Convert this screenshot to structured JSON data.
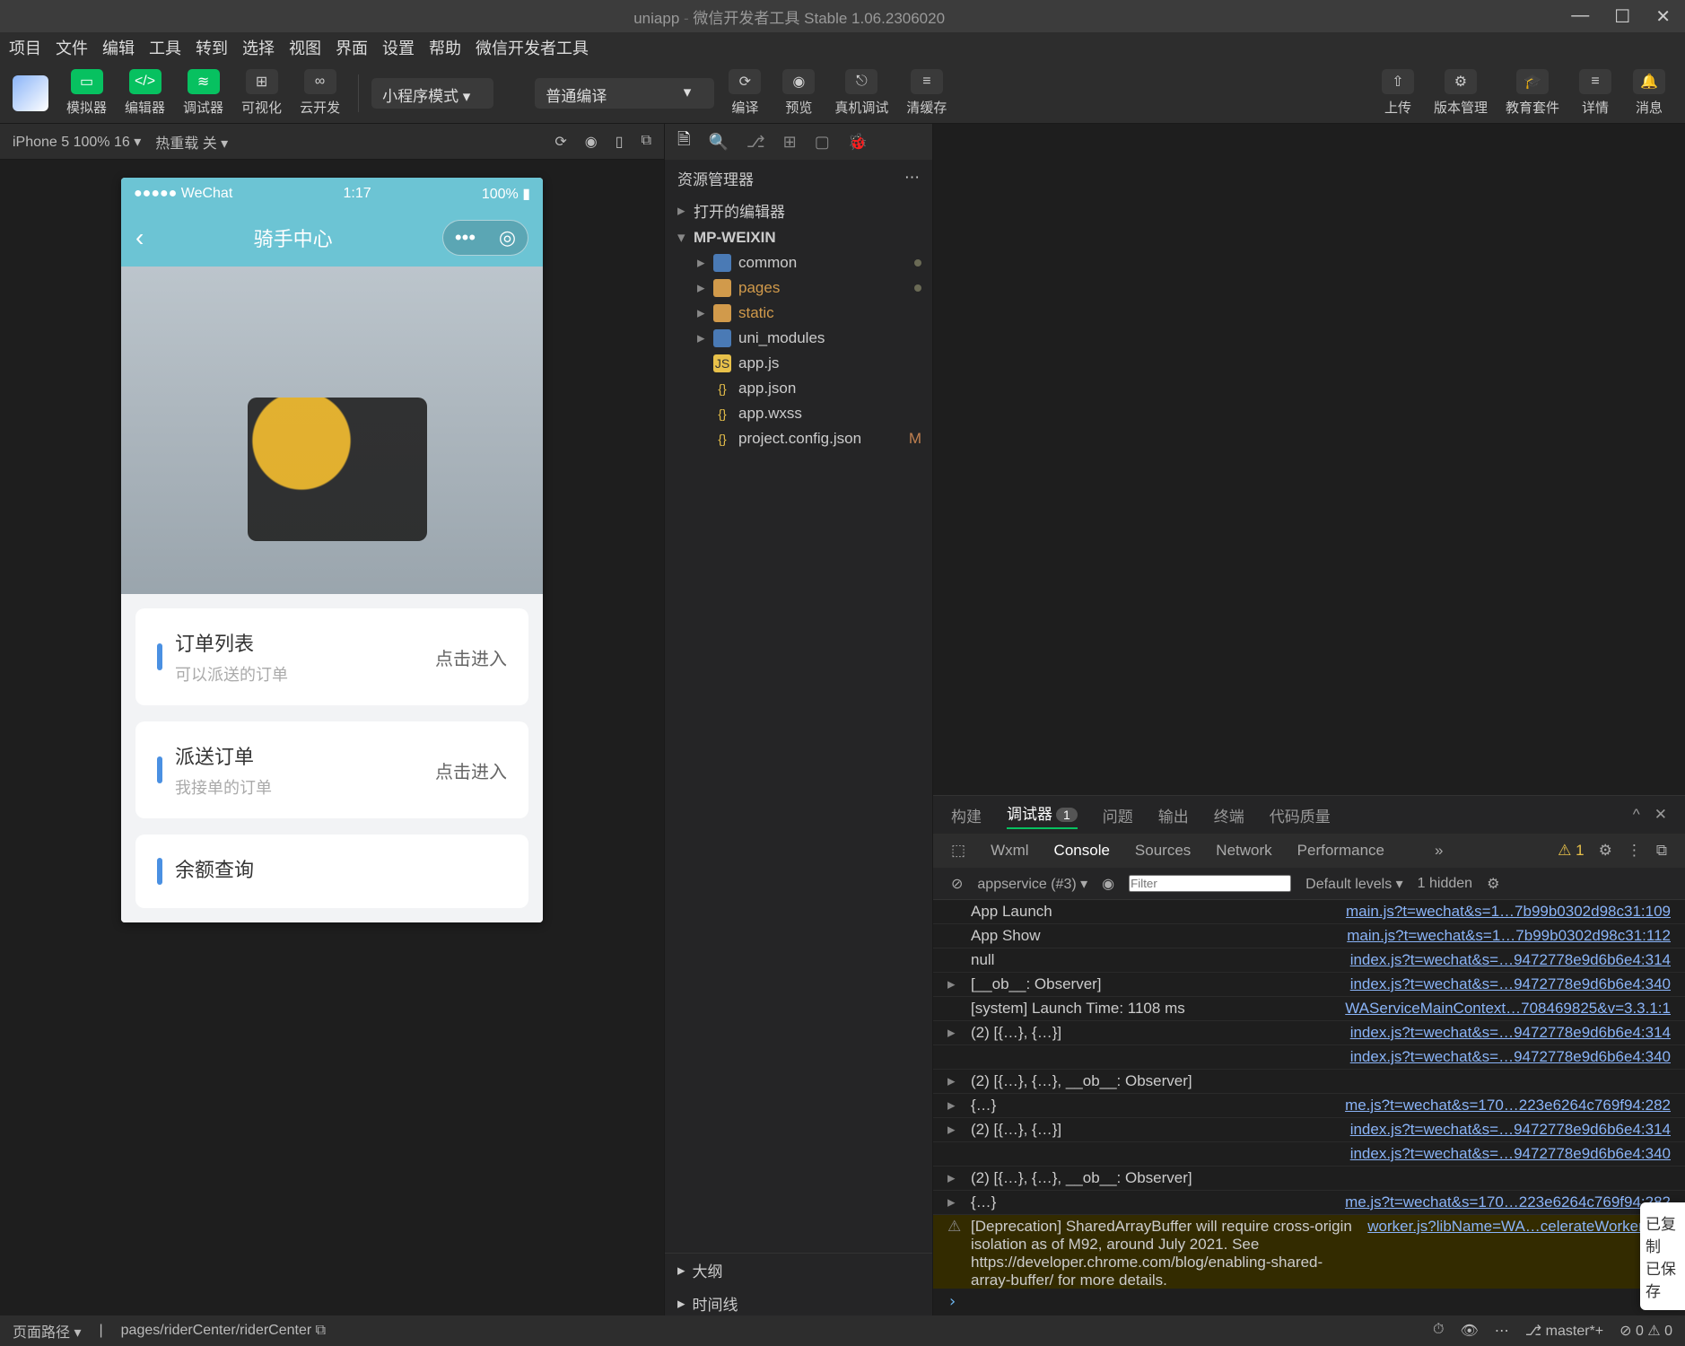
{
  "title": {
    "project": "uniapp",
    "app": "微信开发者工具 Stable 1.06.2306020"
  },
  "menu": [
    "项目",
    "文件",
    "编辑",
    "工具",
    "转到",
    "选择",
    "视图",
    "界面",
    "设置",
    "帮助",
    "微信开发者工具"
  ],
  "toolbar": {
    "simulator": "模拟器",
    "editor": "编辑器",
    "debugger": "调试器",
    "visual": "可视化",
    "cloud": "云开发",
    "mode": "小程序模式",
    "compile": "普通编译",
    "build": "编译",
    "preview": "预览",
    "remote": "真机调试",
    "cache": "清缓存",
    "upload": "上传",
    "version": "版本管理",
    "edu": "教育套件",
    "detail": "详情",
    "msg": "消息"
  },
  "simbar": {
    "device": "iPhone 5 100% 16",
    "hot": "热重载 关"
  },
  "phone": {
    "carrier": "●●●●● WeChat",
    "time": "1:17",
    "battery": "100%",
    "title": "骑手中心",
    "cards": [
      {
        "title": "订单列表",
        "sub": "可以派送的订单",
        "go": "点击进入"
      },
      {
        "title": "派送订单",
        "sub": "我接单的订单",
        "go": "点击进入"
      },
      {
        "title": "余额查询",
        "sub": "",
        "go": ""
      }
    ]
  },
  "explorer": {
    "title": "资源管理器",
    "open": "打开的编辑器",
    "root": "MP-WEIXIN",
    "items": [
      {
        "name": "common",
        "type": "dir",
        "dot": true
      },
      {
        "name": "pages",
        "type": "dir",
        "dot": true,
        "orange": true
      },
      {
        "name": "static",
        "type": "dir",
        "orange": true
      },
      {
        "name": "uni_modules",
        "type": "dir"
      },
      {
        "name": "app.js",
        "type": "js"
      },
      {
        "name": "app.json",
        "type": "json"
      },
      {
        "name": "app.wxss",
        "type": "wxss"
      },
      {
        "name": "project.config.json",
        "type": "json",
        "m": "M"
      }
    ],
    "outline": "大纲",
    "timeline": "时间线"
  },
  "panel": {
    "tabs": [
      "构建",
      "调试器",
      "问题",
      "输出",
      "终端",
      "代码质量"
    ],
    "active": "调试器",
    "badge": "1",
    "devtabs": [
      "Wxml",
      "Console",
      "Sources",
      "Network",
      "Performance"
    ],
    "devactive": "Console",
    "context": "appservice (#3)",
    "filter": "Filter",
    "levels": "Default levels",
    "hidden": "1 hidden",
    "warn_count": "1"
  },
  "console": [
    {
      "msg": "App Launch",
      "src": "main.js?t=wechat&s=1…7b99b0302d98c31:109"
    },
    {
      "msg": "App Show",
      "src": "main.js?t=wechat&s=1…7b99b0302d98c31:112"
    },
    {
      "msg": "null",
      "src": "index.js?t=wechat&s=…9472778e9d6b6e4:314"
    },
    {
      "msg": "[__ob__: Observer]",
      "src": "index.js?t=wechat&s=…9472778e9d6b6e4:340",
      "exp": true
    },
    {
      "msg": "[system] Launch Time: 1108 ms",
      "src": "WAServiceMainContext…708469825&v=3.3.1:1"
    },
    {
      "msg": "(2) [{…}, {…}]",
      "src": "index.js?t=wechat&s=…9472778e9d6b6e4:314",
      "exp": true
    },
    {
      "msg": "",
      "src": "index.js?t=wechat&s=…9472778e9d6b6e4:340"
    },
    {
      "msg": "(2) [{…}, {…}, __ob__: Observer]",
      "src": "",
      "exp": true
    },
    {
      "msg": "{…}",
      "src": "me.js?t=wechat&s=170…223e6264c769f94:282",
      "exp": true
    },
    {
      "msg": "(2) [{…}, {…}]",
      "src": "index.js?t=wechat&s=…9472778e9d6b6e4:314",
      "exp": true
    },
    {
      "msg": "",
      "src": "index.js?t=wechat&s=…9472778e9d6b6e4:340"
    },
    {
      "msg": "(2) [{…}, {…}, __ob__: Observer]",
      "src": "",
      "exp": true
    },
    {
      "msg": "{…}",
      "src": "me.js?t=wechat&s=170…223e6264c769f94:282",
      "exp": true
    }
  ],
  "warn": {
    "text": "[Deprecation] SharedArrayBuffer will require cross-origin isolation as of M92, around July 2021. See https://developer.chrome.com/blog/enabling-shared-array-buffer/ for more details.",
    "src": "worker.js?libName=WA…celerateWorker.js:1"
  },
  "status": {
    "path_label": "页面路径",
    "path": "pages/riderCenter/riderCenter",
    "branch": "master*+",
    "err": "⊘ 0 ⚠ 0"
  },
  "toast": "已复制\n已保存"
}
